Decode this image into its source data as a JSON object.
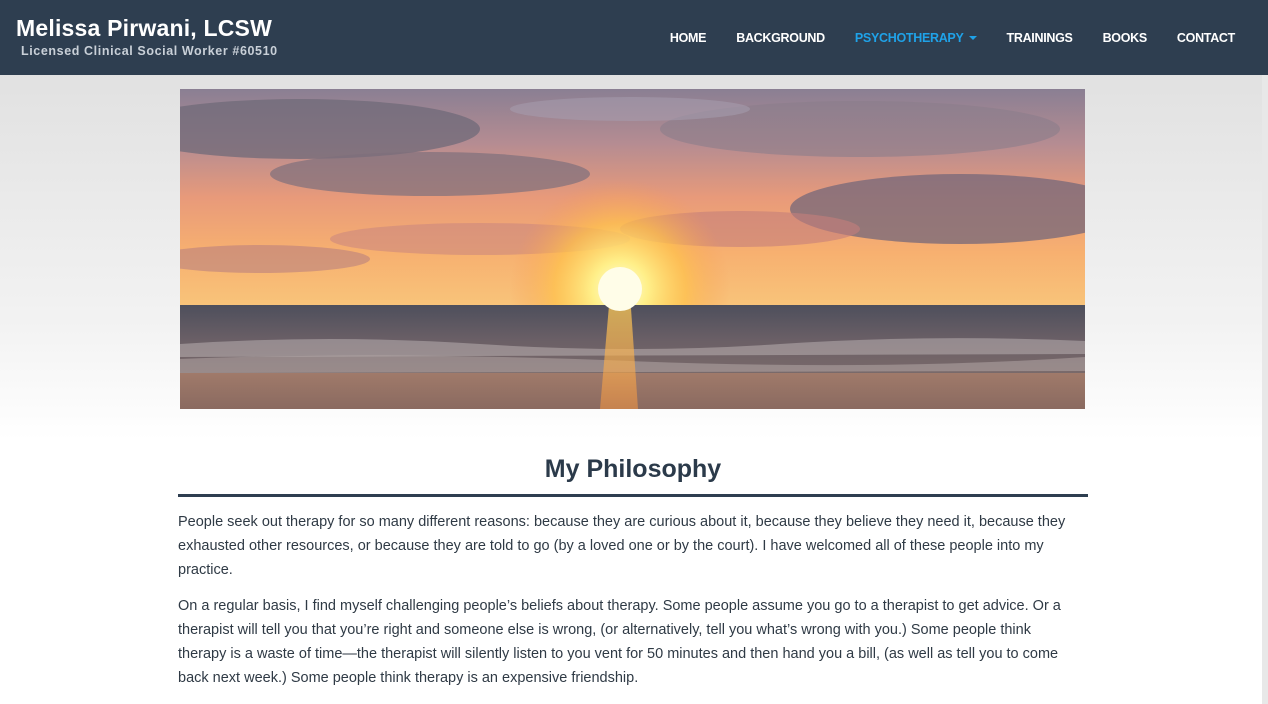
{
  "brand": {
    "title": "Melissa Pirwani, LCSW",
    "subtitle": "Licensed Clinical Social Worker #60510"
  },
  "nav": {
    "items": [
      {
        "label": "HOME"
      },
      {
        "label": "BACKGROUND"
      },
      {
        "label": "PSYCHOTHERAPY"
      },
      {
        "label": "TRAININGS"
      },
      {
        "label": "BOOKS"
      },
      {
        "label": "CONTACT"
      }
    ],
    "active": "PSYCHOTHERAPY"
  },
  "hero": {
    "icon": "sunset-ocean-image"
  },
  "main": {
    "heading": "My Philosophy",
    "paragraphs": [
      "People seek out therapy for so many different reasons: because they are curious about it, because they believe they need it, because they exhausted other resources, or because they are told to go (by a loved one or by the court). I have welcomed all of these people into my practice.",
      "On a regular basis, I find myself challenging people’s beliefs about therapy. Some people assume you go to a therapist to get advice. Or a therapist will tell you that you’re right and someone else is wrong, (or alternatively, tell you what’s wrong with you.) Some people think therapy is a waste of time—the therapist will silently listen to you vent for 50 minutes and then hand you a bill, (as well as tell you to come back next week.) Some people think therapy is an expensive friendship."
    ]
  },
  "colors": {
    "navbar": "#2e3e50",
    "accent": "#1fa2e8",
    "heading": "#2b3a4a"
  }
}
